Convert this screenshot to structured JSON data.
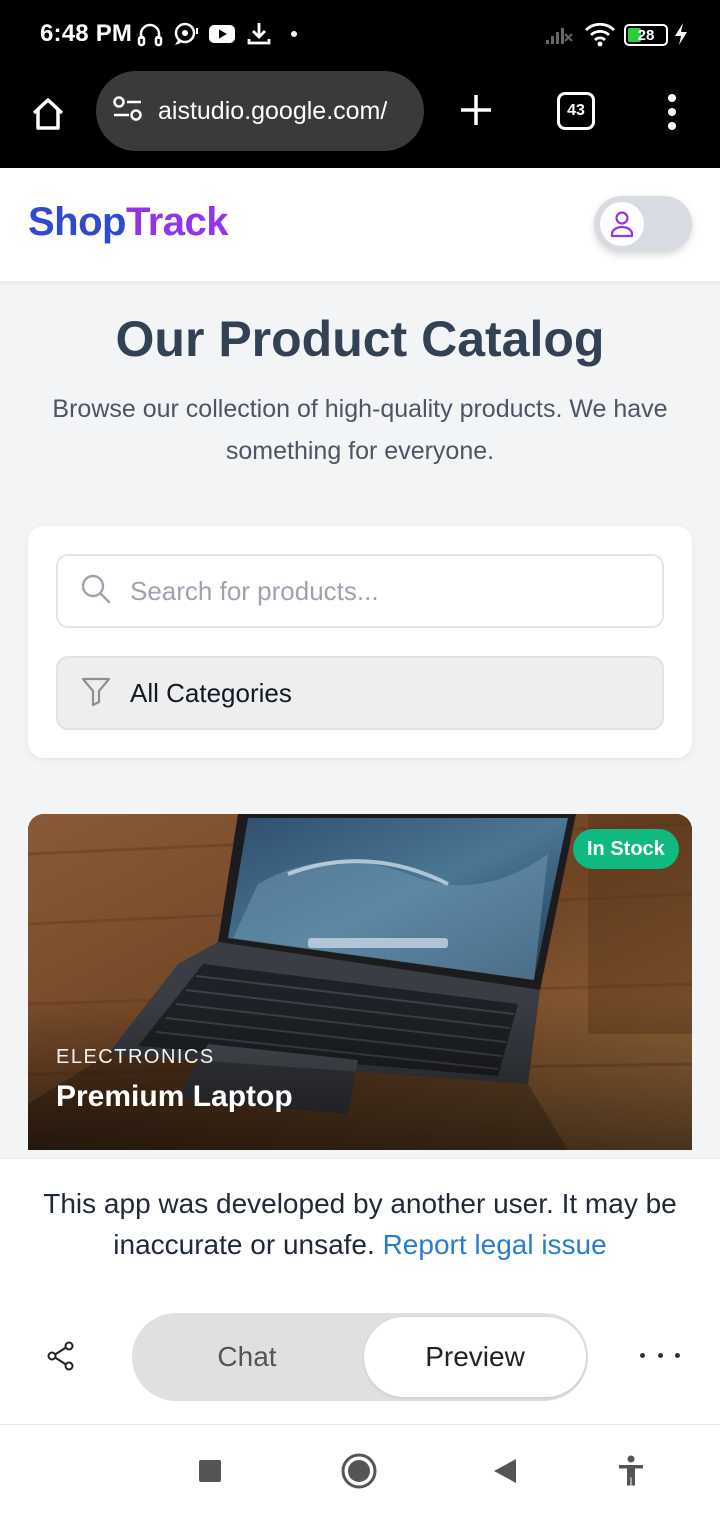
{
  "status_bar": {
    "time": "6:48 PM",
    "battery": "28",
    "icons": [
      "headset-icon",
      "chat-bubble-icon",
      "youtube-icon",
      "download-icon",
      "dot-icon",
      "signal-icon",
      "wifi-icon",
      "battery-icon",
      "charging-icon"
    ]
  },
  "browser": {
    "url": "aistudio.google.com/",
    "tab_count": "43"
  },
  "app": {
    "logo_part1": "Shop",
    "logo_part2": "Track",
    "colors": {
      "brand_blue": "#2f49d1",
      "brand_purple": "#9333ea",
      "in_stock_green": "#10b981",
      "link_blue": "#2a7bd6"
    }
  },
  "hero": {
    "title": "Our Product Catalog",
    "subtitle": "Browse our collection of high-quality products. We have something for everyone."
  },
  "filters": {
    "search_placeholder": "Search for products...",
    "category_selected": "All Categories"
  },
  "products": [
    {
      "badge": "In Stock",
      "category": "ELECTRONICS",
      "name": "Premium Laptop"
    }
  ],
  "disclaimer": {
    "text": "This app was developed by another user. It may be inaccurate or unsafe.",
    "link": "Report legal issue"
  },
  "bottom_tabs": {
    "chat": "Chat",
    "preview": "Preview"
  }
}
